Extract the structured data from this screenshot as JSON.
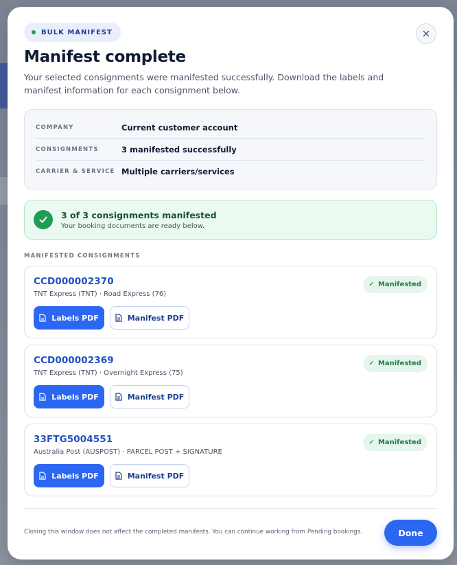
{
  "modal": {
    "badge": "BULK MANIFEST",
    "title": "Manifest complete",
    "intro": "Your selected consignments were manifested successfully. Download the labels and manifest information for each consignment below.",
    "close_icon": "close-icon"
  },
  "summary": {
    "rows": [
      {
        "key": "COMPANY",
        "value": "Current customer account"
      },
      {
        "key": "CONSIGNMENTS",
        "value": "3 manifested successfully"
      },
      {
        "key": "CARRIER & SERVICE",
        "value": "Multiple carriers/services"
      }
    ]
  },
  "success": {
    "title": "3 of 3 consignments manifested",
    "subtitle": "Your booking documents are ready below."
  },
  "list": {
    "label": "MANIFESTED CONSIGNMENTS",
    "items": [
      {
        "ref": "CCD000002370",
        "service": "TNT Express (TNT) · Road Express (76)",
        "status": "Manifested",
        "labels_btn": "Labels PDF",
        "manifest_btn": "Manifest PDF"
      },
      {
        "ref": "CCD000002369",
        "service": "TNT Express (TNT) · Overnight Express (75)",
        "status": "Manifested",
        "labels_btn": "Labels PDF",
        "manifest_btn": "Manifest PDF"
      },
      {
        "ref": "33FTG5004551",
        "service": "Australia Post (AUSPOST) · PARCEL POST + SIGNATURE",
        "status": "Manifested",
        "labels_btn": "Labels PDF",
        "manifest_btn": "Manifest PDF"
      }
    ]
  },
  "footer": {
    "note": "Closing this window does not affect the completed manifests. You can continue working from Pending bookings.",
    "done": "Done"
  },
  "colors": {
    "accent": "#2c67f2",
    "success": "#1f9d55",
    "link": "#2151c2"
  }
}
